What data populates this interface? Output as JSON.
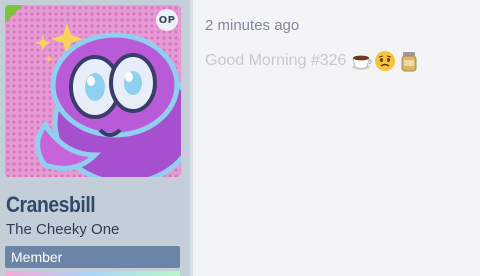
{
  "post": {
    "author": {
      "name": "Cranesbill",
      "title": "The Cheeky One",
      "rank": "Member",
      "op_badge": "OP",
      "avatar_icon": "cartoon-avatar-icon"
    },
    "timestamp": "2 minutes ago",
    "message": "Good Morning #326",
    "emojis": [
      "coffee-icon",
      "worried-face-icon",
      "jar-icon"
    ]
  },
  "colors": {
    "username": "#2f4a6b",
    "member_badge": "#6c84a6",
    "sidebar_bg": "#c3ced9",
    "content_bg": "#f3f4f6",
    "op_flag": "#7cc43a"
  }
}
